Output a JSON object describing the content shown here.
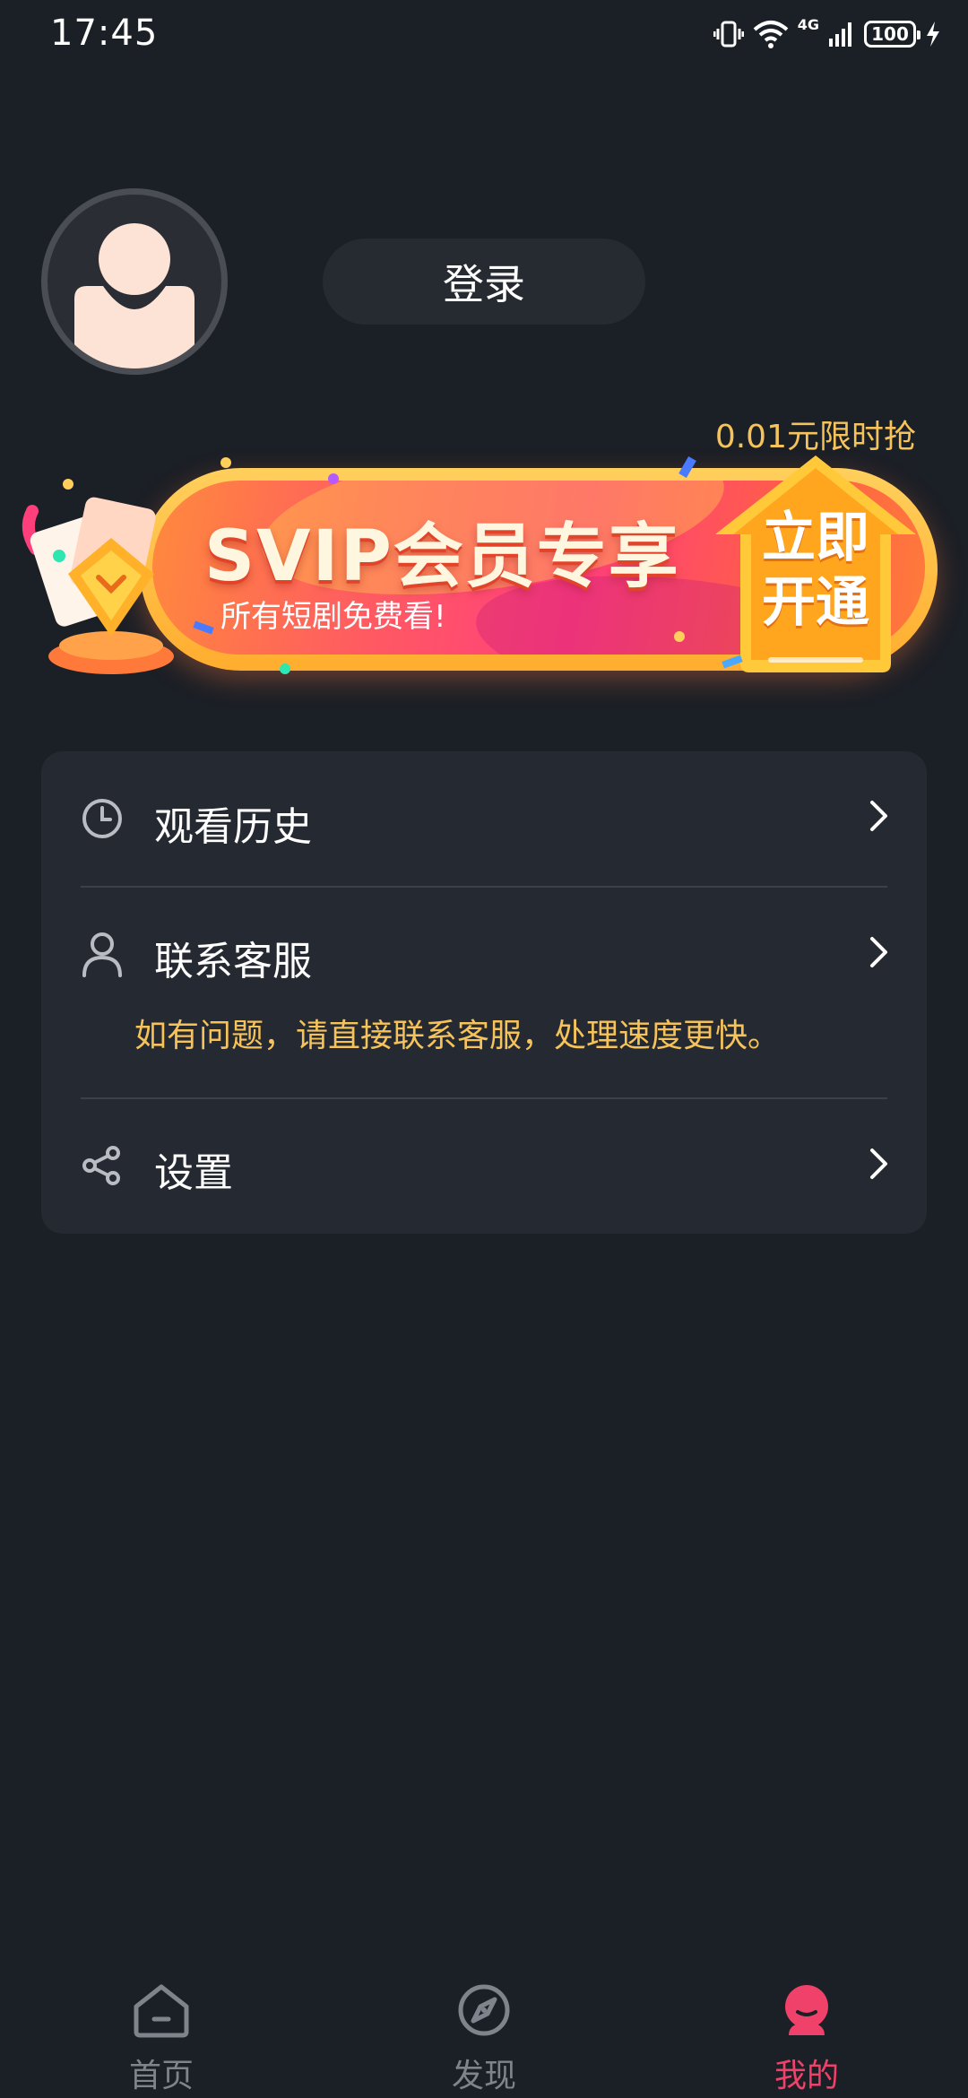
{
  "status_bar": {
    "time": "17:45",
    "network": "4G",
    "battery": "100"
  },
  "profile": {
    "login_label": "登录"
  },
  "promo": {
    "tag": "0.01元限时抢",
    "title": "SVIP会员专享",
    "subtitle": "所有短剧免费看!",
    "button_line1": "立即",
    "button_line2": "开通"
  },
  "menu": {
    "items": [
      {
        "label": "观看历史",
        "icon": "clock-icon"
      },
      {
        "label": "联系客服",
        "icon": "user-icon",
        "hint": "如有问题，请直接联系客服，处理速度更快。"
      },
      {
        "label": "设置",
        "icon": "share-icon"
      }
    ]
  },
  "nav": {
    "items": [
      {
        "label": "首页",
        "icon": "home-icon"
      },
      {
        "label": "发现",
        "icon": "discover-icon"
      },
      {
        "label": "我的",
        "icon": "profile-icon",
        "active": true
      }
    ]
  },
  "colors": {
    "background": "#1b1f26",
    "card": "#252931",
    "accent_gold": "#f6c35a",
    "accent_pink": "#f0416a",
    "inactive": "#7f838b"
  }
}
